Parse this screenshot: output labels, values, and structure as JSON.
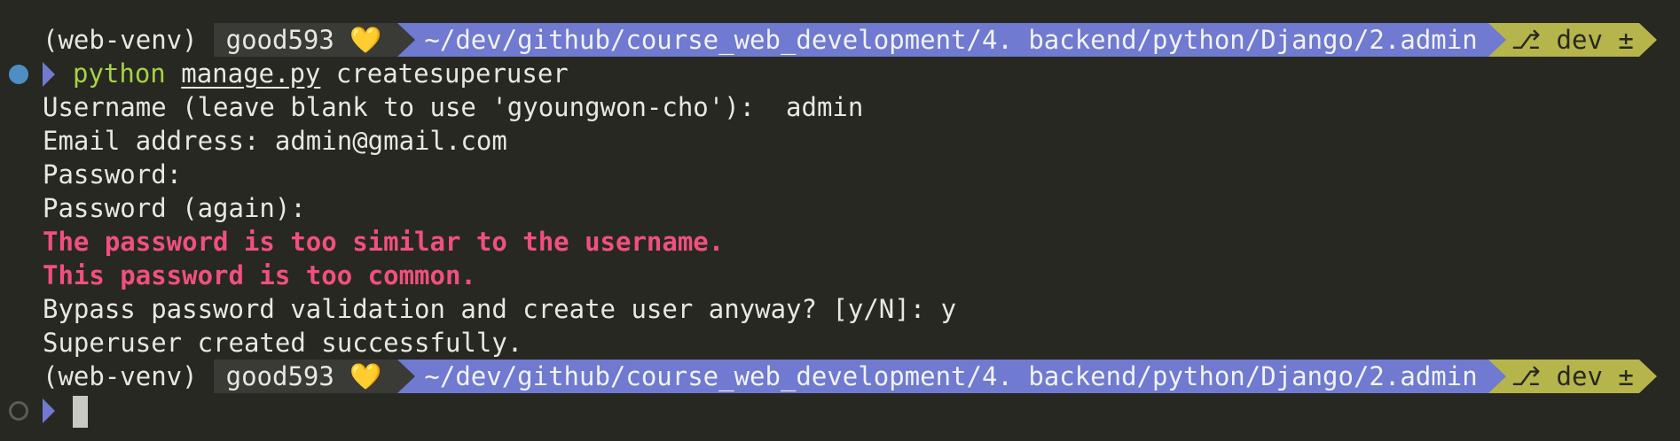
{
  "prompt": {
    "venv": "(web-venv)",
    "user": "good593",
    "heart": "💛",
    "path": "~/dev/github/course_web_development/4. backend/python/Django/2.admin",
    "git_icon": "⎇",
    "branch": "dev ±"
  },
  "command": {
    "program": "python",
    "script": "manage.py",
    "subcommand": "createsuperuser"
  },
  "output": {
    "username_prompt": "Username (leave blank to use 'gyoungwon-cho'):  admin",
    "email_prompt": "Email address: admin@gmail.com",
    "password_prompt": "Password:",
    "password_again_prompt": "Password (again):",
    "error_similar": "The password is too similar to the username.",
    "error_common": "This password is too common.",
    "bypass_prompt": "Bypass password validation and create user anyway? [y/N]: y",
    "success": "Superuser created successfully."
  },
  "colors": {
    "background": "#272822",
    "path_segment": "#6f7ad0",
    "git_segment": "#b6b54b",
    "error_text": "#f0507d",
    "command_green": "#a6d243",
    "status_dot_done": "#4d8fc4"
  }
}
